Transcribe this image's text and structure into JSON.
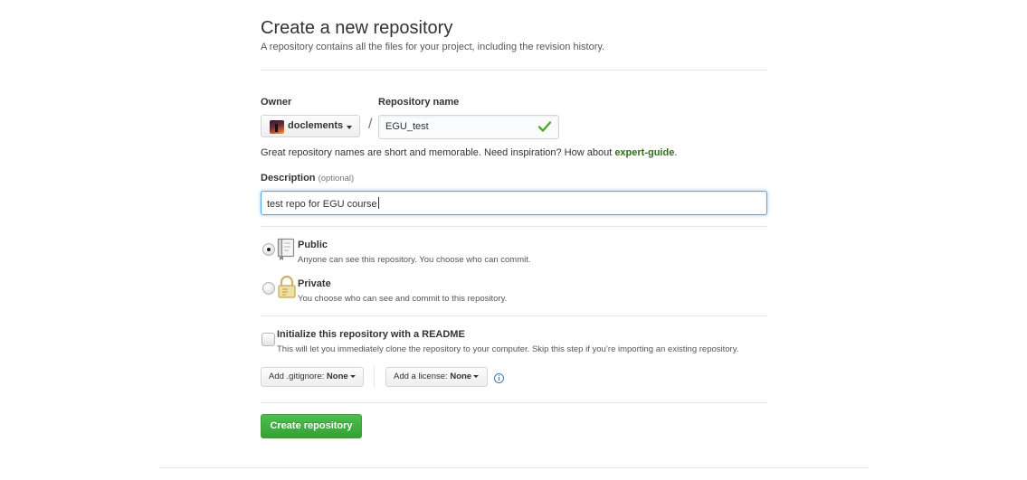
{
  "header": {
    "title": "Create a new repository",
    "subtitle": "A repository contains all the files for your project, including the revision history."
  },
  "owner": {
    "label": "Owner",
    "value": "doclements"
  },
  "repo_name": {
    "label": "Repository name",
    "value": "EGU_test",
    "hint_prefix": "Great repository names are short and memorable. Need inspiration? How about ",
    "suggestion": "expert-guide",
    "hint_suffix": "."
  },
  "separator": "/",
  "description": {
    "label": "Description",
    "optional": "(optional)",
    "value": "test repo for EGU course"
  },
  "visibility": {
    "selected": "public",
    "public": {
      "title": "Public",
      "desc": "Anyone can see this repository. You choose who can commit."
    },
    "private": {
      "title": "Private",
      "desc": "You choose who can see and commit to this repository."
    }
  },
  "readme": {
    "checked": false,
    "title": "Initialize this repository with a README",
    "desc": "This will let you immediately clone the repository to your computer. Skip this step if you’re importing an existing repository."
  },
  "gitignore": {
    "label": "Add .gitignore:",
    "value": "None"
  },
  "license": {
    "label": "Add a license:",
    "value": "None"
  },
  "info_icon": "info-icon",
  "submit_label": "Create repository",
  "colors": {
    "primary_button": "#34a034",
    "link_green": "#2f6f1e",
    "focus_blue": "#51a7e8",
    "check_green": "#55a532"
  }
}
